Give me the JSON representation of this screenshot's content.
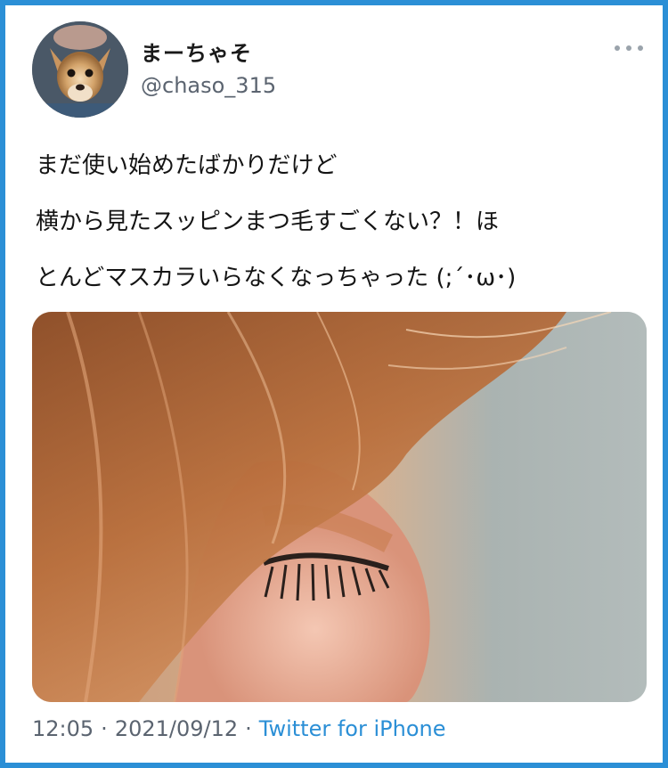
{
  "user": {
    "display_name": "まーちゃそ",
    "handle": "@chaso_315"
  },
  "tweet": {
    "lines": [
      "まだ使い始めたばかりだけど",
      "横から見たスッピンまつ毛すごくない？！ほ",
      "とんどマスカラいらなくなっちゃった (;´･ω･)"
    ]
  },
  "meta": {
    "time": "12:05",
    "separator": "·",
    "date": "2021/09/12",
    "source": "Twitter for iPhone"
  },
  "icons": {
    "more": "more-horizontal-icon"
  },
  "colors": {
    "frame": "#2b8fd6",
    "link": "#2b8fd6",
    "secondary_text": "#5b6470"
  }
}
